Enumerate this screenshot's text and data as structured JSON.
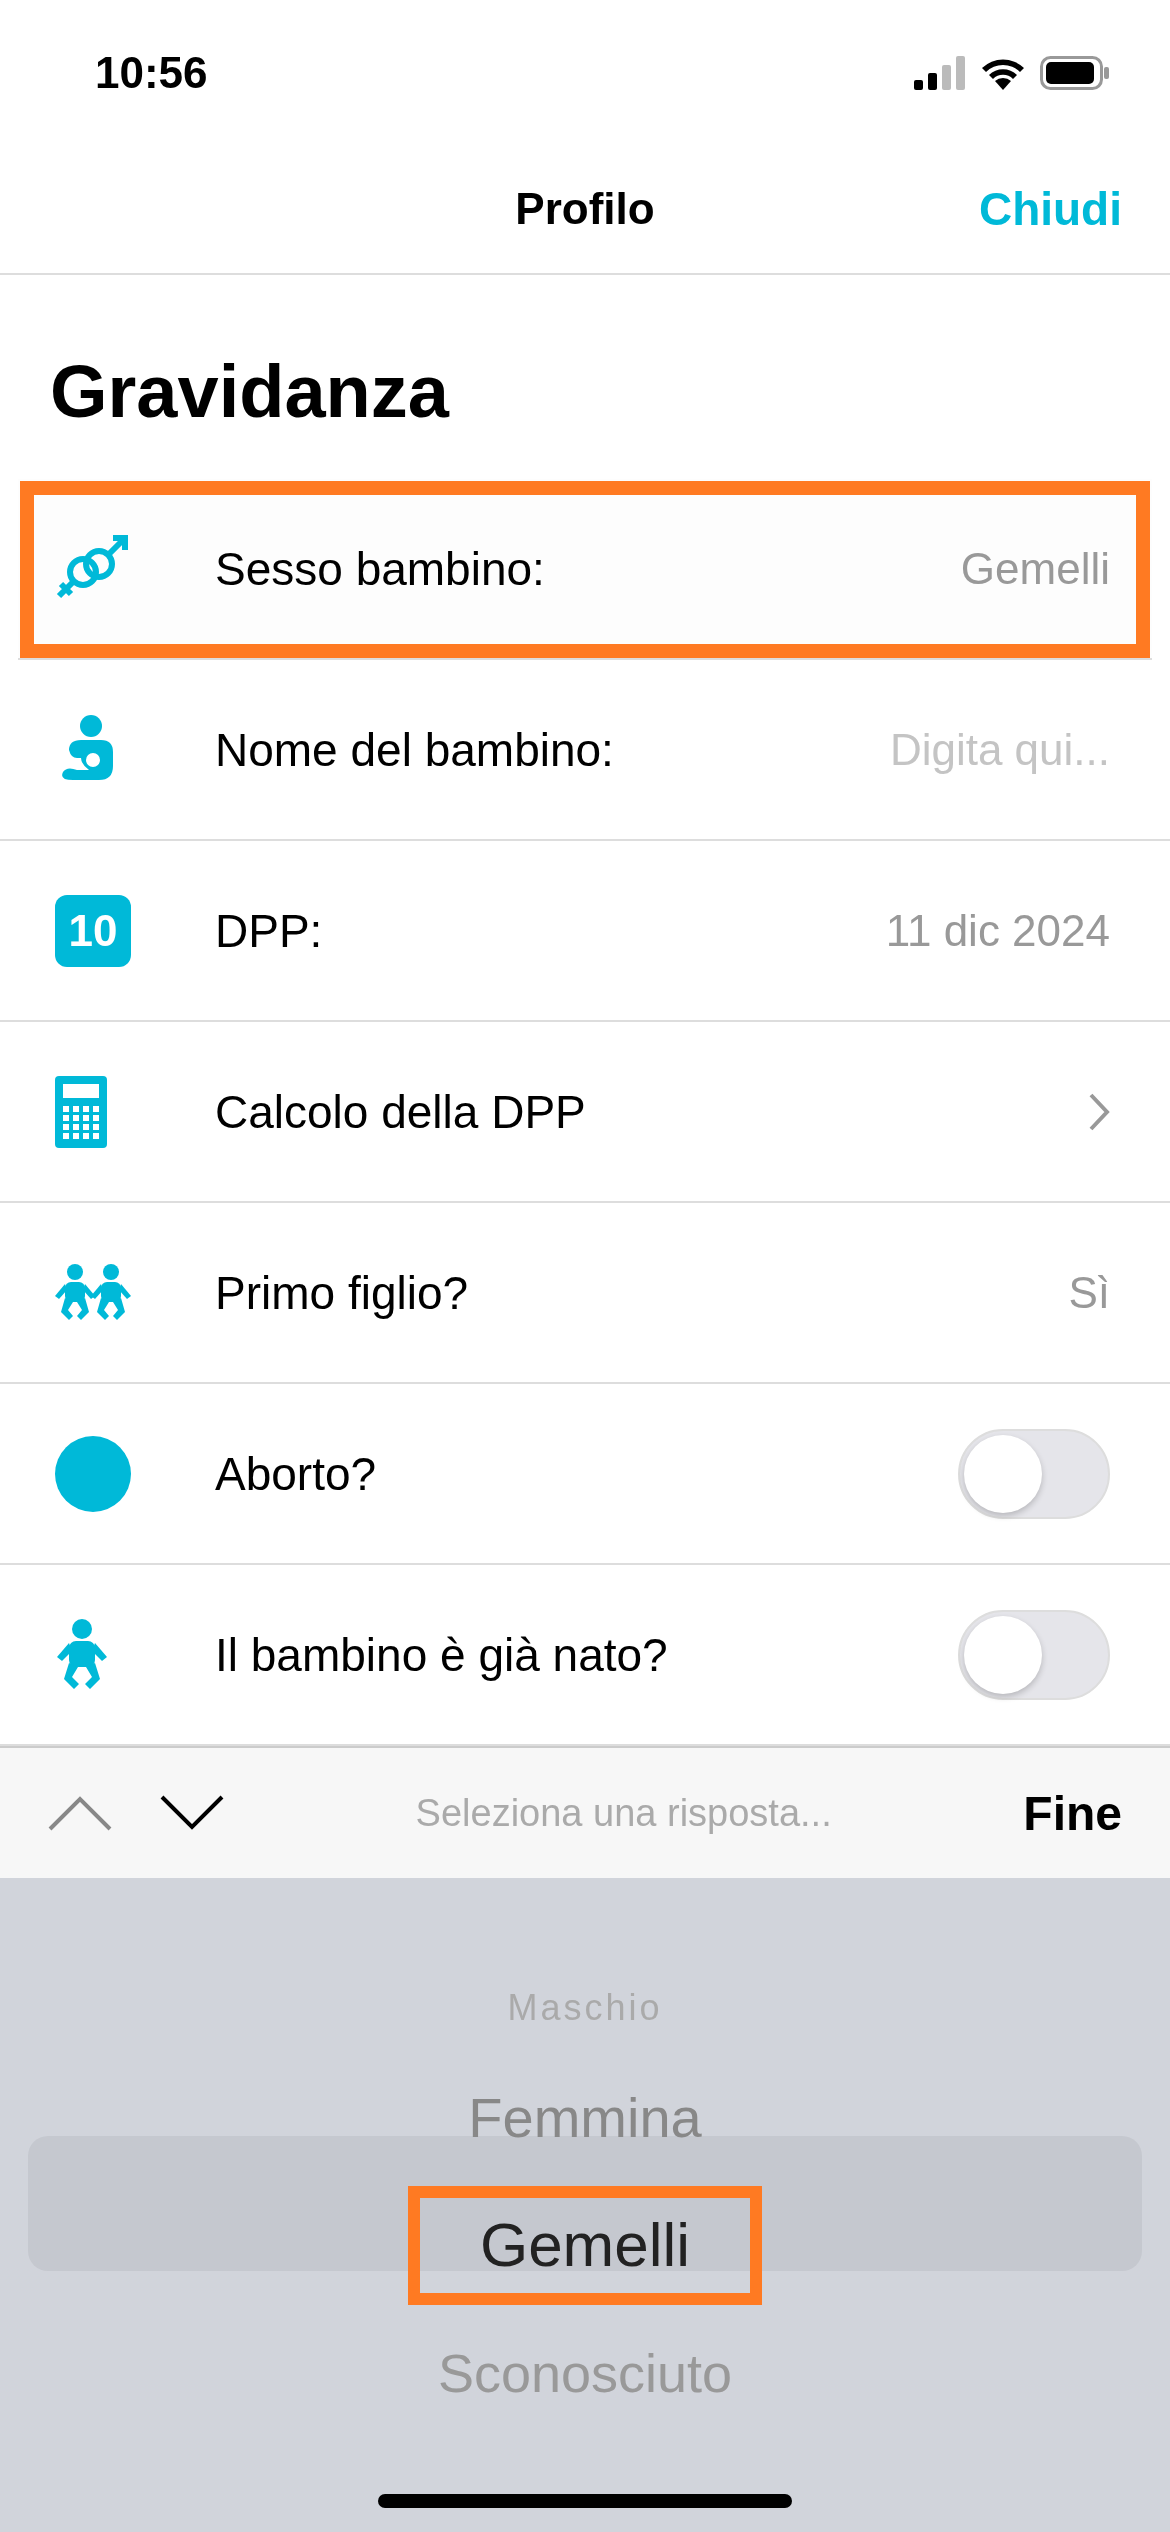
{
  "status_bar": {
    "time": "10:56"
  },
  "nav": {
    "title": "Profilo",
    "close": "Chiudi"
  },
  "title": "Gravidanza",
  "rows": [
    {
      "kind": "value",
      "label": "Sesso bambino:",
      "value": "Gemelli",
      "highlighted": true
    },
    {
      "kind": "field",
      "label": "Nome del bambino:",
      "placeholder": "Digita qui..."
    },
    {
      "kind": "value",
      "icon_text": "10",
      "label": "DPP:",
      "value": "11 dic 2024"
    },
    {
      "kind": "link",
      "label": "Calcolo della DPP"
    },
    {
      "kind": "value",
      "label": "Primo figlio?",
      "value": "Sì"
    },
    {
      "kind": "toggle",
      "label": "Aborto?",
      "on": false
    },
    {
      "kind": "toggle",
      "label": "Il bambino è già nato?",
      "on": false
    }
  ],
  "toolbar": {
    "prompt": "Seleziona una risposta...",
    "done": "Fine"
  },
  "picker": [
    {
      "label": "Maschio",
      "selected": false,
      "highlighted": false
    },
    {
      "label": "Femmina",
      "selected": false,
      "highlighted": false
    },
    {
      "label": "Gemelli",
      "selected": true,
      "highlighted": true
    },
    {
      "label": "Sconosciuto",
      "selected": false,
      "highlighted": false
    }
  ]
}
